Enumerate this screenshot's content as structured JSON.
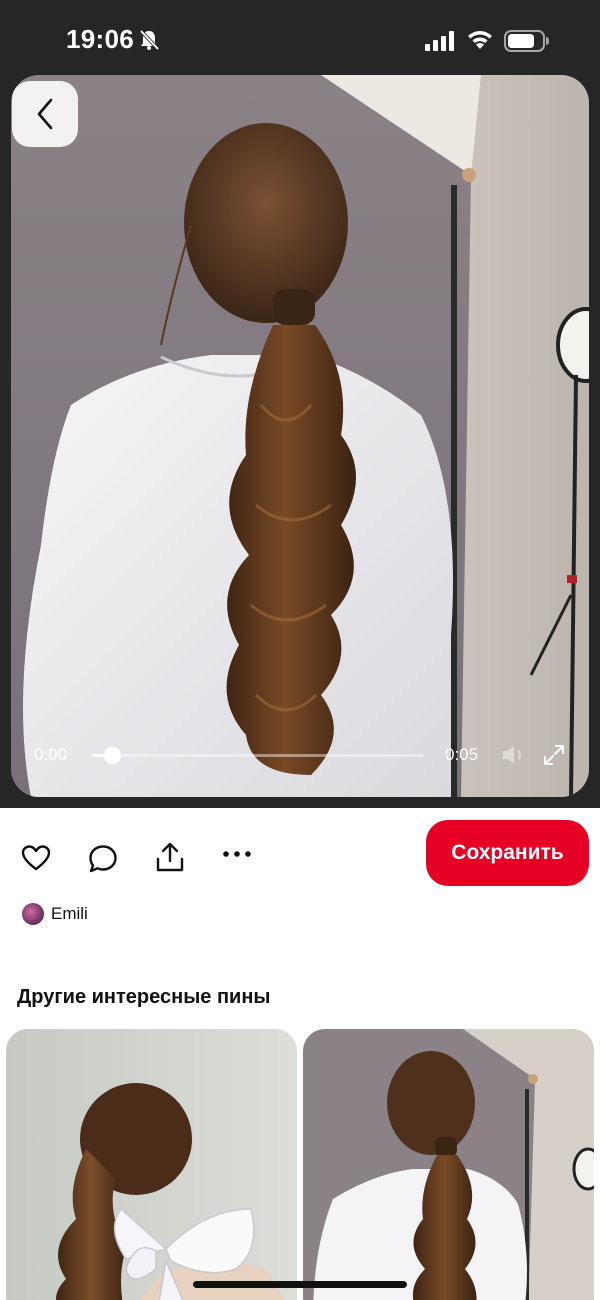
{
  "status_bar": {
    "time": "19:06",
    "icons": [
      "bell-slash-icon",
      "signal-icon",
      "wifi-icon",
      "battery-icon"
    ]
  },
  "navigation": {
    "back_icon": "chevron-left-icon"
  },
  "video": {
    "current_time": "0:00",
    "total_time": "0:05",
    "progress_fraction": 0.06,
    "controls": [
      "volume-muted-icon",
      "expand-icon"
    ]
  },
  "actions": {
    "icons": [
      "heart-icon",
      "comment-icon",
      "share-icon",
      "more-icon"
    ],
    "save_label": "Сохранить",
    "save_color": "#e60023"
  },
  "author": {
    "name": "Emili"
  },
  "related": {
    "title": "Другие интересные пины",
    "pins": [
      {
        "subject": "ponytail-with-white-bow"
      },
      {
        "subject": "wavy-ponytail-white-shirt"
      }
    ]
  }
}
